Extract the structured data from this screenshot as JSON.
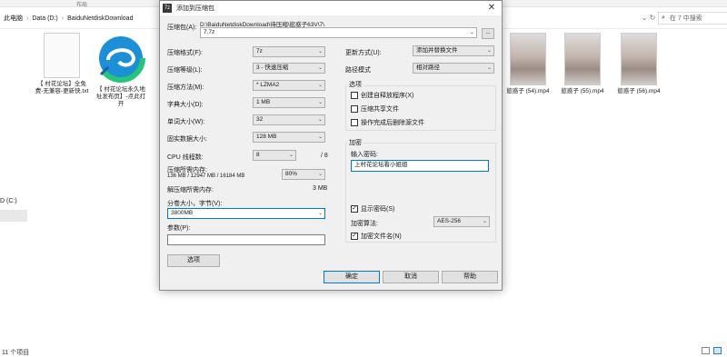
{
  "explorer": {
    "ribbon_label": "布局",
    "breadcrumb": [
      "此电脑",
      "Data (D:)",
      "BaiduNetdiskDownload"
    ],
    "search_placeholder": "在 7 中搜索",
    "nav_drive": "D (C:)",
    "status": "11 个项目",
    "files": [
      {
        "name": "【 村花论坛】全免费-无兼容-更新快.txt",
        "kind": "doc"
      },
      {
        "name": "【 村花论坛永久地址发布页】-点此打开",
        "kind": "edge"
      },
      {
        "name": "慾惑子 (54).mp4",
        "kind": "photo"
      },
      {
        "name": "慾惑子 (55).mp4",
        "kind": "photo"
      },
      {
        "name": "慾惑子 (56).mp4",
        "kind": "photo"
      }
    ]
  },
  "dialog": {
    "title": "添加到压缩包",
    "archive_label": "压缩包(A):",
    "archive_path": "D:\\BaiduNetdiskDownload\\待压缩\\慾惑子63V\\7\\",
    "archive_name": "7.7z",
    "browse_label": "...",
    "format_label": "压缩格式(F):",
    "format_value": "7z",
    "level_label": "压缩等级(L):",
    "level_value": "3 - 快速压缩",
    "method_label": "压缩方法(M):",
    "method_value": "* LZMA2",
    "dict_label": "字典大小(D):",
    "dict_value": "1 MB",
    "word_label": "单词大小(W):",
    "word_value": "32",
    "solid_label": "固实数据大小:",
    "solid_value": "128 MB",
    "cpu_label": "CPU 线程数:",
    "cpu_value": "8",
    "cpu_total": "/ 8",
    "mem_label": "压缩所需内存:",
    "mem_detail": "136 MB / 12947 MB / 16184 MB",
    "mem_percent": "80%",
    "decomp_label": "解压缩所需内存:",
    "decomp_value": "3 MB",
    "split_label": "分卷大小，字节(V):",
    "split_value": "3800MB",
    "params_label": "参数(P):",
    "params_value": "",
    "options_button": "选项",
    "update_label": "更新方式(U):",
    "update_value": "添加并替换文件",
    "path_label": "路径模式",
    "path_value": "相对路径",
    "options_group": "选项",
    "opt_sfx": "创建自释放程序(X)",
    "opt_shared": "压缩共享文件",
    "opt_delete": "操作完成后删除源文件",
    "encrypt_group": "加密",
    "password_label": "输入密码:",
    "password_value": "上村花论坛看小姐姐",
    "show_password": "显示密码(S)",
    "encrypt_method_label": "加密算法:",
    "encrypt_method_value": "AES-256",
    "encrypt_names": "加密文件名(N)",
    "ok_button": "确定",
    "cancel_button": "取消",
    "help_button": "帮助",
    "close_glyph": "✕",
    "check_glyph": "✓",
    "combo_arrow": "⌄"
  }
}
